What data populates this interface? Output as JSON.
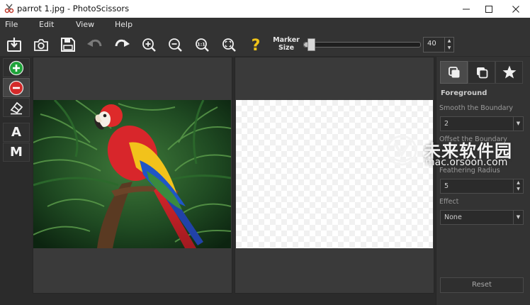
{
  "window": {
    "title": "parrot 1.jpg - PhotoScissors",
    "controls": [
      "minimize-icon",
      "maximize-icon",
      "close-icon"
    ]
  },
  "menu": [
    "File",
    "Edit",
    "View",
    "Help"
  ],
  "toolbar": {
    "buttons": [
      "open-icon",
      "camera-icon",
      "save-icon",
      "undo-icon",
      "redo-icon",
      "zoom-in-icon",
      "zoom-out-icon",
      "actual-size-icon",
      "zoom-fit-icon",
      "help-icon"
    ],
    "marker_label_line1": "Marker",
    "marker_label_line2": "Size",
    "marker_size": "40",
    "marker_slider_level": 0.06
  },
  "left_tools": {
    "buttons": [
      "add-foreground-icon",
      "remove-background-icon",
      "eraser-icon"
    ],
    "letter_a": "A",
    "letter_m": "M"
  },
  "right_panel": {
    "tabs": [
      "foreground-tab-icon",
      "background-tab-icon",
      "effects-tab-icon"
    ],
    "section_title": "Foreground",
    "smooth_label": "Smooth the Boundary",
    "smooth_value": "2",
    "offset_label": "Offset the Boundary",
    "feather_label": "Feathering Radius",
    "feather_value": "5",
    "effect_label": "Effect",
    "effect_value": "None",
    "reset_label": "Reset"
  },
  "watermark": {
    "chinese": "未来软件园",
    "url": "mac.orsoon.com"
  },
  "colors": {
    "background": "#2b2b2b",
    "panel": "#333333",
    "add_green": "#1fa33a",
    "remove_red": "#d42a2a",
    "help_yellow": "#f0c419"
  }
}
